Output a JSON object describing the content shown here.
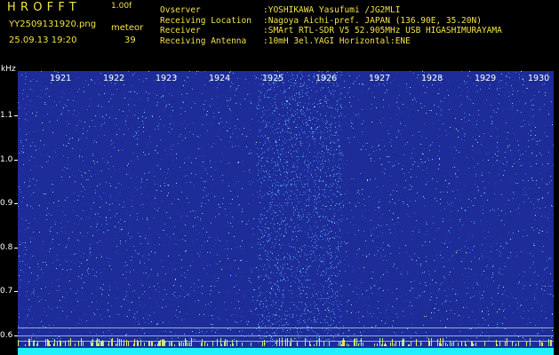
{
  "header": {
    "app_title": "HROFFT",
    "version": "1.00f",
    "filename": "YY2509131920.png",
    "mode": "meteor",
    "datetime": "25.09.13 19:20",
    "count": "39"
  },
  "info": [
    {
      "label": "Ovserver",
      "value": ":YOSHIKAWA Yasufumi /JG2MLI"
    },
    {
      "label": "Receiving Location",
      "value": ":Nagoya Aichi-pref. JAPAN (136.90E, 35.20N)"
    },
    {
      "label": "Receiver",
      "value": ":SMArt RTL-SDR V5 52.905MHz USB HIGASHIMURAYAMA"
    },
    {
      "label": "Receiving Antenna",
      "value": ":10mH 3el.YAGI Horizontal:ENE"
    }
  ],
  "axes": {
    "y_label": "kHz",
    "y_ticks": [
      "1.1",
      "1.0",
      "0.9",
      "0.8",
      "0.7",
      "0.6"
    ],
    "x_ticks": [
      "1921",
      "1922",
      "1923",
      "1924",
      "1925",
      "1926",
      "1927",
      "1928",
      "1929",
      "1930"
    ]
  },
  "colors": {
    "text_yellow": "#f2e24a",
    "background": "#1d2c98",
    "band": "#20f0ff"
  }
}
